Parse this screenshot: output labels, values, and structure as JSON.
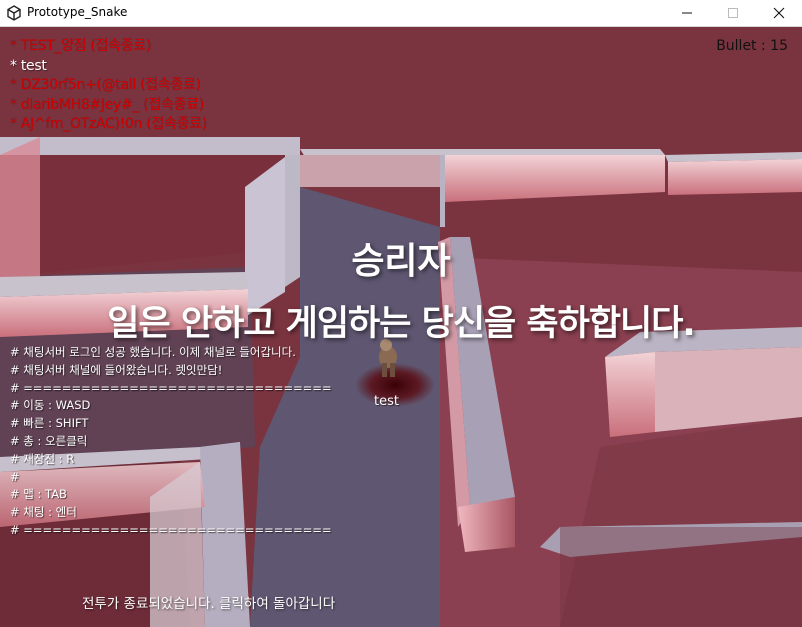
{
  "window": {
    "title": "Prototype_Snake",
    "icon": "unity-icon",
    "controls": [
      "minimize-icon",
      "maximize-icon",
      "close-icon"
    ]
  },
  "hud": {
    "bullet_label": "Bullet : ",
    "bullet_count": "15"
  },
  "players": [
    {
      "name": "* TEST_양점 (접속종료)",
      "status": "disconnected"
    },
    {
      "name": "* test",
      "status": "connected"
    },
    {
      "name": "* DZ30rf5n+(@tall (접속종료)",
      "status": "disconnected"
    },
    {
      "name": "* dlaribMH8#Jey#_ (접속종료)",
      "status": "disconnected"
    },
    {
      "name": "* AJ^fm_OTzAC)!0n (접속종료)",
      "status": "disconnected"
    }
  ],
  "victory": {
    "title": "승리자",
    "message": "일은 안하고 게임하는 당신을 축하합니다."
  },
  "chat_log": [
    "# 채팅서버 로그인 성공 했습니다. 이제 채널로 들어갑니다.",
    "# 채팅서버 채널에 들어왔습니다. 렛잇만담!",
    "# ================================",
    "# 이동 : WASD",
    "# 빠른 : SHIFT",
    "# 총 : 오른클릭",
    "# 재장전 : R",
    "#",
    "# 맵 : TAB",
    "# 채팅 : 엔터",
    "# ================================"
  ],
  "player_character": {
    "name": "test"
  },
  "footer": {
    "message": "전투가 종료되었습니다. 클릭하여 돌아갑니다"
  },
  "colors": {
    "disconnected_text": "#d00000",
    "floor": "#6e2f3a",
    "wall_top": "#b5aeb9",
    "wall_side": "#e2a0a8"
  }
}
